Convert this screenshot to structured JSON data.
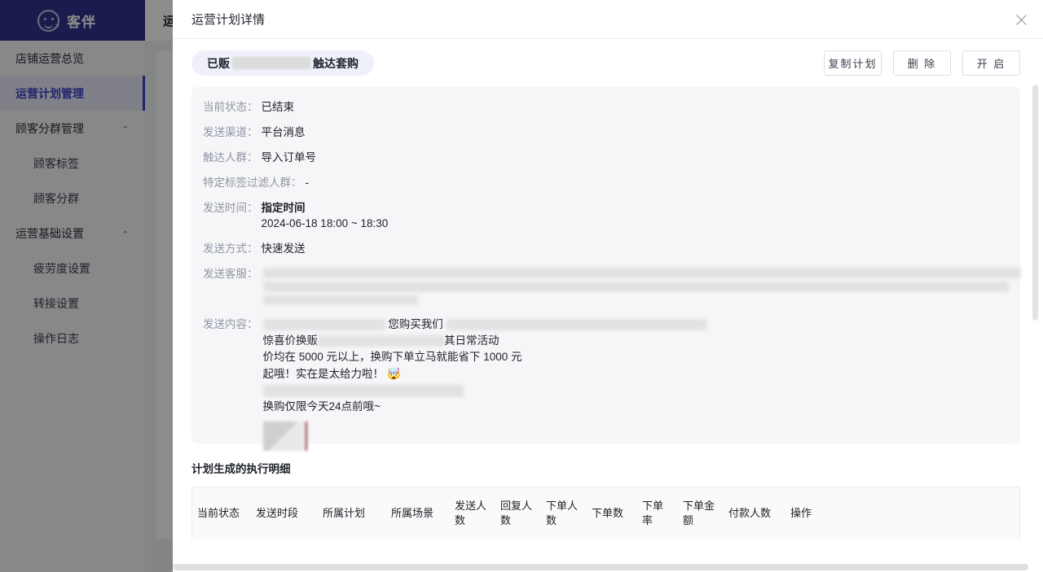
{
  "brand": {
    "name": "客伴",
    "logo_icon": "smiley-arrow-logo"
  },
  "sidebar": {
    "items": [
      {
        "label": "店铺运营总览",
        "level": "top",
        "active": false,
        "caret": ""
      },
      {
        "label": "运营计划管理",
        "level": "top",
        "active": true,
        "caret": ""
      },
      {
        "label": "顾客分群管理",
        "level": "top",
        "active": false,
        "caret": "⌄"
      },
      {
        "label": "顾客标签",
        "level": "sub",
        "active": false,
        "caret": ""
      },
      {
        "label": "顾客分群",
        "level": "sub",
        "active": false,
        "caret": ""
      },
      {
        "label": "运营基础设置",
        "level": "top",
        "active": false,
        "caret": "⌄"
      },
      {
        "label": "疲劳度设置",
        "level": "sub",
        "active": false,
        "caret": ""
      },
      {
        "label": "转接设置",
        "level": "sub",
        "active": false,
        "caret": ""
      },
      {
        "label": "操作日志",
        "level": "sub",
        "active": false,
        "caret": ""
      }
    ]
  },
  "background": {
    "page_title": "运营计划管理"
  },
  "modal": {
    "title": "运营计划详情",
    "close_icon": "close-icon",
    "plan_chip": {
      "prefix": "已贩",
      "redacted": true,
      "suffix": "触达套购"
    },
    "actions": [
      {
        "label": "复制计划",
        "name": "copy-plan-button"
      },
      {
        "label": "删 除",
        "name": "delete-button"
      },
      {
        "label": "开 启",
        "name": "enable-button"
      }
    ],
    "details": {
      "status": {
        "label": "当前状态：",
        "value": "已结束"
      },
      "channel": {
        "label": "发送渠道：",
        "value": "平台消息"
      },
      "audience": {
        "label": "触达人群：",
        "value": "导入订单号"
      },
      "tag_filter": {
        "label": "特定标签过滤人群：",
        "value": "-"
      },
      "send_time": {
        "label": "发送时间：",
        "value_main": "指定时间",
        "value_range": "2024-06-18 18:00 ~ 18:30"
      },
      "send_method": {
        "label": "发送方式：",
        "value": "快速发送"
      },
      "send_agent": {
        "label": "发送客服：",
        "value_redacted": true
      },
      "send_content": {
        "label": "发送内容：",
        "lines": [
          {
            "pre_redact": true,
            "text": "您购买我们",
            "post_redact": true
          },
          {
            "text": "惊喜价换贩",
            "mid_redact": true,
            "text2": "其日常活动"
          },
          {
            "text": "价均在 5000 元以上，换购下单立马就能省下 1000 元"
          },
          {
            "text": "起哦！实在是太给力啦！",
            "emoji": "🤯"
          },
          {
            "redact_line": true
          },
          {
            "text": "换购仅限今天24点前哦~"
          }
        ],
        "thumbnail": "blurred-image-thumbnail"
      }
    },
    "table": {
      "title": "计划生成的执行明细",
      "columns": [
        "当前状态",
        "发送时段",
        "所属计划",
        "所属场景",
        "发送人数",
        "回复人数",
        "下单人数",
        "下单数",
        "下单率",
        "下单金额",
        "付款人数",
        "操作"
      ]
    }
  }
}
